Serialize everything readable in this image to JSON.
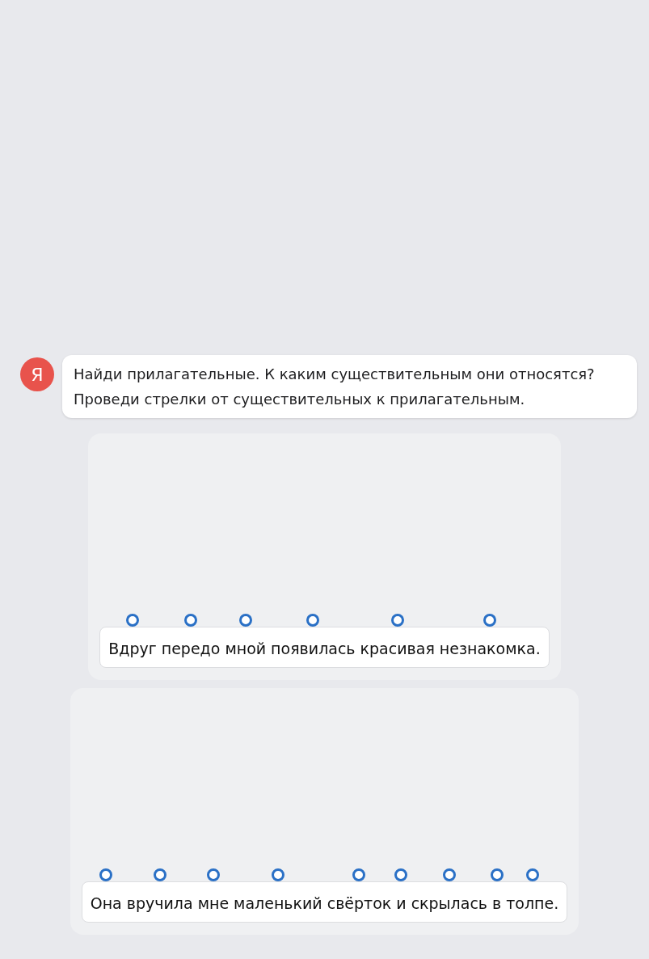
{
  "message": {
    "avatar": "Я",
    "lines": [
      "Найди прилагательные. К каким существительным они относятся?",
      "Проведи стрелки от существительных к прилагательным."
    ]
  },
  "exercises": [
    {
      "words": [
        "Вдруг",
        "передо",
        "мной",
        "появилась",
        "красивая",
        "незнакомка."
      ]
    },
    {
      "words": [
        "Она",
        "вручила",
        "мне",
        "маленький",
        "свёрток",
        "и",
        "скрылась",
        "в",
        "толпе."
      ]
    }
  ]
}
